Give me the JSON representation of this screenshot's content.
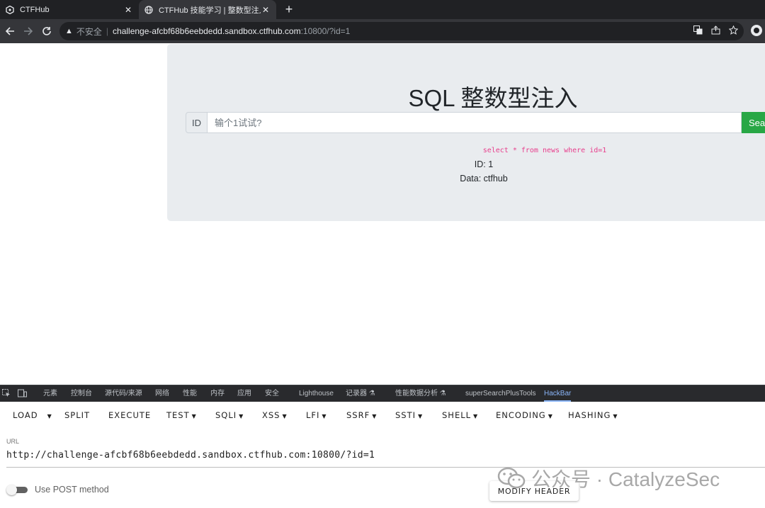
{
  "browser": {
    "tabs": [
      {
        "title": "CTFHub",
        "close": "✕"
      },
      {
        "title": "CTFHub 技能学习 | 整数型注入",
        "close": "✕"
      }
    ],
    "new_tab": "+",
    "address": {
      "warning": "▲",
      "insecure_label": "不安全",
      "separator": "|",
      "host": "challenge-afcbf68b6eebdedd.sandbox.ctfhub.com",
      "path": ":10800/?id=1"
    }
  },
  "page": {
    "title": "SQL 整数型注入",
    "id_label": "ID",
    "input_placeholder": "输个1试试?",
    "search_label": "Search",
    "sql": "select * from news where id=1",
    "result_id": "ID: 1",
    "result_data": "Data: ctfhub"
  },
  "devtools": {
    "tabs": [
      "元素",
      "控制台",
      "源代码/来源",
      "网络",
      "性能",
      "内存",
      "应用",
      "安全",
      "Lighthouse",
      "记录器 ⚗",
      "性能数据分析 ⚗",
      "superSearchPlusTools",
      "HackBar"
    ],
    "active_tab": "HackBar"
  },
  "hackbar": {
    "buttons": [
      {
        "label": "LOAD",
        "caret": "▼"
      },
      {
        "label": "SPLIT",
        "caret": ""
      },
      {
        "label": "EXECUTE",
        "caret": ""
      },
      {
        "label": "TEST",
        "caret": "▼"
      },
      {
        "label": "SQLI",
        "caret": "▼"
      },
      {
        "label": "XSS",
        "caret": "▼"
      },
      {
        "label": "LFI",
        "caret": "▼"
      },
      {
        "label": "SSRF",
        "caret": "▼"
      },
      {
        "label": "SSTI",
        "caret": "▼"
      },
      {
        "label": "SHELL",
        "caret": "▼"
      },
      {
        "label": "ENCODING",
        "caret": "▼"
      },
      {
        "label": "HASHING",
        "caret": "▼"
      }
    ],
    "url_label": "URL",
    "url_value": "http://challenge-afcbf68b6eebdedd.sandbox.ctfhub.com:10800/?id=1",
    "post_label": "Use POST method",
    "post_enabled": false,
    "modify_header": "MODIFY HEADER"
  },
  "watermark": {
    "text": "公众号 · CatalyzeSec"
  },
  "colors": {
    "search_button": "#28a745",
    "sql_text": "#e83e8c",
    "active_devtools_tab": "#8ab4f8"
  }
}
